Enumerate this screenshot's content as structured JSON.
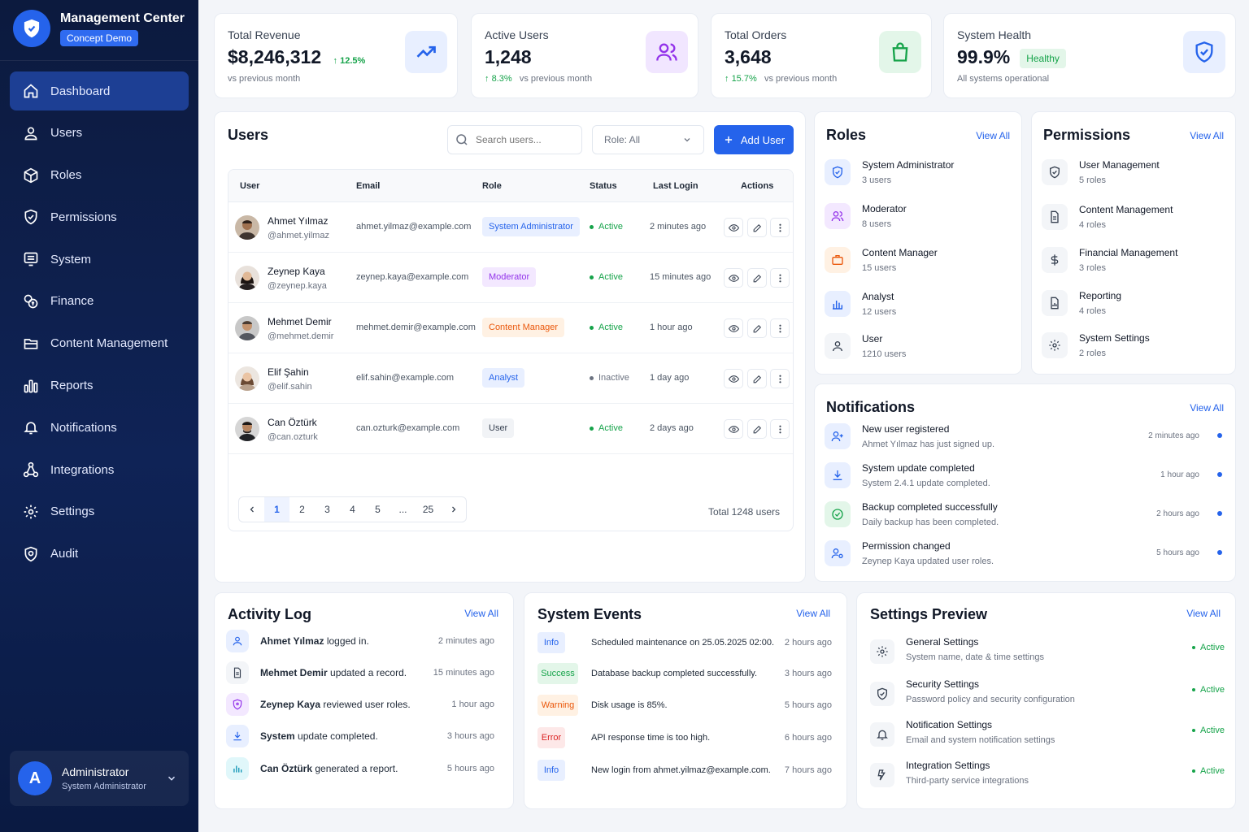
{
  "brand": {
    "title": "Management Center",
    "badge": "Concept Demo"
  },
  "nav": [
    {
      "label": "Dashboard",
      "icon": "home-icon"
    },
    {
      "label": "Users",
      "icon": "user-icon"
    },
    {
      "label": "Roles",
      "icon": "cube-icon"
    },
    {
      "label": "Permissions",
      "icon": "shield-check-icon"
    },
    {
      "label": "System",
      "icon": "monitor-icon"
    },
    {
      "label": "Finance",
      "icon": "coins-icon"
    },
    {
      "label": "Content Management",
      "icon": "folder-icon"
    },
    {
      "label": "Reports",
      "icon": "bar-chart-icon"
    },
    {
      "label": "Notifications",
      "icon": "bell-icon"
    },
    {
      "label": "Integrations",
      "icon": "share-nodes-icon"
    },
    {
      "label": "Settings",
      "icon": "gear-icon"
    },
    {
      "label": "Audit",
      "icon": "shield-audit-icon"
    }
  ],
  "profile": {
    "initial": "A",
    "name": "Administrator",
    "role": "System Administrator"
  },
  "stats": [
    {
      "label": "Total Revenue",
      "value": "$8,246,312",
      "change": "12.5%",
      "sub": "vs previous month"
    },
    {
      "label": "Active Users",
      "value": "1,248",
      "change": "8.3%",
      "sub": "vs previous month"
    },
    {
      "label": "Total Orders",
      "value": "3,648",
      "change": "15.7%",
      "sub": "vs previous month"
    },
    {
      "label": "System Health",
      "value": "99.9%",
      "badge": "Healthy",
      "sub": "All systems operational"
    }
  ],
  "users_panel": {
    "title": "Users",
    "search_placeholder": "Search users...",
    "role_filter": "Role: All",
    "add_label": "Add User",
    "columns": [
      "User",
      "Email",
      "Role",
      "Status",
      "Last Login",
      "Actions"
    ],
    "rows": [
      {
        "name": "Ahmet Yılmaz",
        "handle": "@ahmet.yilmaz",
        "email": "ahmet.yilmaz@example.com",
        "role": "System Administrator",
        "status": "Active",
        "last": "2 minutes ago"
      },
      {
        "name": "Zeynep Kaya",
        "handle": "@zeynep.kaya",
        "email": "zeynep.kaya@example.com",
        "role": "Moderator",
        "status": "Active",
        "last": "15 minutes ago"
      },
      {
        "name": "Mehmet Demir",
        "handle": "@mehmet.demir",
        "email": "mehmet.demir@example.com",
        "role": "Content Manager",
        "status": "Active",
        "last": "1 hour ago"
      },
      {
        "name": "Elif Şahin",
        "handle": "@elif.sahin",
        "email": "elif.sahin@example.com",
        "role": "Analyst",
        "status": "Inactive",
        "last": "1 day ago"
      },
      {
        "name": "Can Öztürk",
        "handle": "@can.ozturk",
        "email": "can.ozturk@example.com",
        "role": "User",
        "status": "Active",
        "last": "2 days ago"
      }
    ],
    "pages": [
      "1",
      "2",
      "3",
      "4",
      "5",
      "...",
      "25"
    ],
    "total": "Total 1248 users"
  },
  "roles_panel": {
    "title": "Roles",
    "view_all": "View All",
    "items": [
      {
        "name": "System Administrator",
        "count": "3 users"
      },
      {
        "name": "Moderator",
        "count": "8 users"
      },
      {
        "name": "Content Manager",
        "count": "15 users"
      },
      {
        "name": "Analyst",
        "count": "12 users"
      },
      {
        "name": "User",
        "count": "1210 users"
      }
    ]
  },
  "permissions_panel": {
    "title": "Permissions",
    "view_all": "View All",
    "items": [
      {
        "name": "User Management",
        "count": "5 roles"
      },
      {
        "name": "Content Management",
        "count": "4 roles"
      },
      {
        "name": "Financial Management",
        "count": "3 roles"
      },
      {
        "name": "Reporting",
        "count": "4 roles"
      },
      {
        "name": "System Settings",
        "count": "2 roles"
      }
    ]
  },
  "notifications_panel": {
    "title": "Notifications",
    "view_all": "View All",
    "items": [
      {
        "title": "New user registered",
        "sub": "Ahmet Yılmaz has just signed up.",
        "time": "2 minutes ago"
      },
      {
        "title": "System update completed",
        "sub": "System 2.4.1 update completed.",
        "time": "1 hour ago"
      },
      {
        "title": "Backup completed successfully",
        "sub": "Daily backup has been completed.",
        "time": "2 hours ago"
      },
      {
        "title": "Permission changed",
        "sub": "Zeynep Kaya updated user roles.",
        "time": "5 hours ago"
      }
    ]
  },
  "activity_panel": {
    "title": "Activity Log",
    "view_all": "View All",
    "items": [
      {
        "actor": "Ahmet Yılmaz",
        "action": "logged in.",
        "time": "2 minutes ago"
      },
      {
        "actor": "Mehmet Demir",
        "action": "updated a record.",
        "time": "15 minutes ago"
      },
      {
        "actor": "Zeynep Kaya",
        "action": "reviewed user roles.",
        "time": "1 hour ago"
      },
      {
        "actor": "System",
        "action": "update completed.",
        "time": "3 hours ago"
      },
      {
        "actor": "Can Öztürk",
        "action": "generated a report.",
        "time": "5 hours ago"
      }
    ]
  },
  "events_panel": {
    "title": "System Events",
    "view_all": "View All",
    "items": [
      {
        "level": "Info",
        "text": "Scheduled maintenance on 25.05.2025 02:00.",
        "time": "2 hours ago"
      },
      {
        "level": "Success",
        "text": "Database backup completed successfully.",
        "time": "3 hours ago"
      },
      {
        "level": "Warning",
        "text": "Disk usage is 85%.",
        "time": "5 hours ago"
      },
      {
        "level": "Error",
        "text": "API response time is too high.",
        "time": "6 hours ago"
      },
      {
        "level": "Info",
        "text": "New login from ahmet.yilmaz@example.com.",
        "time": "7 hours ago"
      }
    ]
  },
  "settings_panel": {
    "title": "Settings Preview",
    "view_all": "View All",
    "items": [
      {
        "title": "General Settings",
        "sub": "System name, date & time settings",
        "status": "Active"
      },
      {
        "title": "Security Settings",
        "sub": "Password policy and security configuration",
        "status": "Active"
      },
      {
        "title": "Notification Settings",
        "sub": "Email and system notification settings",
        "status": "Active"
      },
      {
        "title": "Integration Settings",
        "sub": "Third-party service integrations",
        "status": "Active"
      }
    ]
  },
  "colors": {
    "accent": "#2563eb",
    "sidebar": "#0f2356",
    "success": "#16a34a",
    "warning": "#ea580c",
    "error": "#dc2626",
    "purple": "#9333ea"
  }
}
